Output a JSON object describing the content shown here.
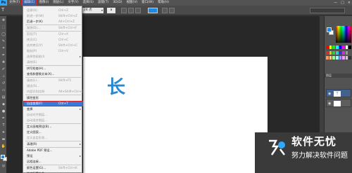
{
  "menubar": {
    "logo": "Ps",
    "items": [
      "文件(F)",
      "编辑(E)",
      "图像(I)",
      "图层(L)",
      "文字(Y)",
      "选择(S)",
      "滤镜(T)",
      "3D(D)",
      "视图(V)",
      "窗口(W)",
      "帮助(H)"
    ],
    "active_index": 1,
    "window_controls": [
      "—",
      "□",
      "×"
    ]
  },
  "options": {
    "font_size": "24 点",
    "antialias": "a",
    "text_color": "#1e88e5",
    "workspace": ""
  },
  "edit_menu": {
    "rows": [
      {
        "label": "还原(O)",
        "shortcut": "Ctrl+Z",
        "disabled": true
      },
      {
        "label": "前进一步(W)",
        "shortcut": "Shift+Ctrl+Z",
        "disabled": true
      },
      {
        "label": "后退一步(K)",
        "shortcut": "Alt+Ctrl+Z",
        "disabled": false
      },
      {
        "label": "渐隐(D)...",
        "shortcut": "Shift+Ctrl+F",
        "disabled": true
      },
      {
        "label": "剪切(T)",
        "shortcut": "Ctrl+X",
        "disabled": true
      },
      {
        "label": "拷贝(C)",
        "shortcut": "Ctrl+C",
        "disabled": true
      },
      {
        "label": "合并拷贝(Y)",
        "shortcut": "Shift+Ctrl+C",
        "disabled": true
      },
      {
        "label": "粘贴(P)",
        "shortcut": "Ctrl+V",
        "disabled": true
      },
      {
        "label": "选择性粘贴(I)",
        "shortcut": "",
        "disabled": true,
        "submenu": true
      },
      {
        "label": "清除(E)",
        "shortcut": "",
        "disabled": true
      },
      {
        "label": "拼写检查(H)...",
        "shortcut": "",
        "disabled": false
      },
      {
        "label": "查找和替换文本(X)...",
        "shortcut": "",
        "disabled": false
      },
      {
        "label": "填充(L)...",
        "shortcut": "Shift+F5",
        "disabled": true
      },
      {
        "label": "描边(S)...",
        "shortcut": "",
        "disabled": true
      },
      {
        "label": "内容识别比例",
        "shortcut": "Alt+Shift+Ctrl+C",
        "disabled": true
      },
      {
        "label": "操控变形",
        "shortcut": "",
        "disabled": false
      },
      {
        "label": "自由变换(F)",
        "shortcut": "Ctrl+T",
        "disabled": false,
        "highlight": true
      },
      {
        "label": "变换",
        "shortcut": "",
        "disabled": false,
        "submenu": true
      },
      {
        "label": "自动对齐图层...",
        "shortcut": "",
        "disabled": true
      },
      {
        "label": "自动混合图层...",
        "shortcut": "",
        "disabled": true
      },
      {
        "label": "定义画笔预设(B)...",
        "shortcut": "",
        "disabled": false
      },
      {
        "label": "定义图案...",
        "shortcut": "",
        "disabled": false
      },
      {
        "label": "定义自定形状...",
        "shortcut": "",
        "disabled": true
      },
      {
        "label": "清理(R)",
        "shortcut": "",
        "disabled": false,
        "submenu": true
      },
      {
        "label": "Adobe PDF 预设...",
        "shortcut": "",
        "disabled": false
      },
      {
        "label": "预设",
        "shortcut": "",
        "disabled": false,
        "submenu": true
      },
      {
        "label": "远程连接...",
        "shortcut": "",
        "disabled": false
      },
      {
        "label": "颜色设置(G)...",
        "shortcut": "Shift+Ctrl+K",
        "disabled": false
      },
      {
        "label": "指定配置文件...",
        "shortcut": "",
        "disabled": false
      }
    ]
  },
  "canvas": {
    "text": "长"
  },
  "layers": {
    "header": "图层",
    "thumb_text": "T"
  },
  "colors": {
    "foreground": "#1e88e5",
    "background": "#ffffff"
  },
  "watermark": {
    "title": "软件无忧",
    "subtitle": "努力解决软件问题"
  }
}
